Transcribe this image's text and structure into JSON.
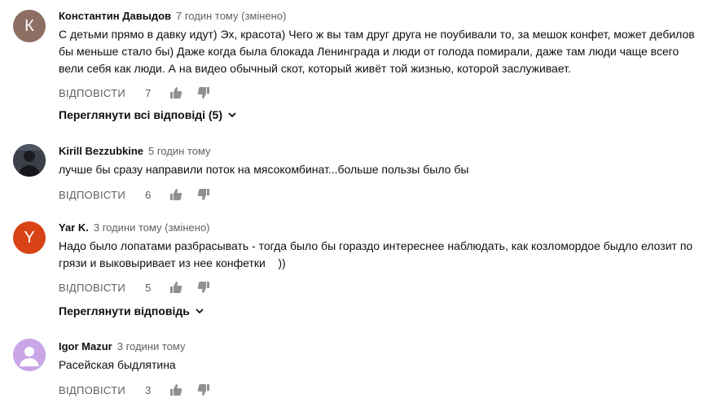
{
  "comments": [
    {
      "avatar_letter": "К",
      "author": "Константин Давыдов",
      "time": "7 годин тому (змінено)",
      "text": "С детьми прямо в давку идут) Эх, красота) Чего ж вы там друг друга не поубивали то, за мешок конфет, может дебилов бы меньше стало бы) Даже когда была блокада Ленинграда и люди от голода помирали, даже там люди чаще всего вели себя как люди. А на видео обычный скот, который живёт той жизнью, которой заслуживает.",
      "reply_label": "ВІДПОВІСТИ",
      "likes": "7",
      "view_replies": "Переглянути всі відповіді (5)"
    },
    {
      "author": "Kirill Bezzubkine",
      "time": "5 годин тому",
      "text": "лучше бы сразу направили поток на мясокомбинат...больше пользы было бы",
      "reply_label": "ВІДПОВІСТИ",
      "likes": "6"
    },
    {
      "avatar_letter": "Y",
      "author": "Yar K.",
      "time": "3 години тому (змінено)",
      "text": "Надо было лопатами разбрасывать - тогда было бы гораздо интереснее наблюдать, как козломордое быдло елозит по грязи и выковыривает из нее конфетки    ))",
      "reply_label": "ВІДПОВІСТИ",
      "likes": "5",
      "view_replies": "Переглянути відповідь"
    },
    {
      "author": "Igor Mazur",
      "time": "3 години тому",
      "text": "Расейская быдлятина",
      "reply_label": "ВІДПОВІСТИ",
      "likes": "3"
    }
  ]
}
